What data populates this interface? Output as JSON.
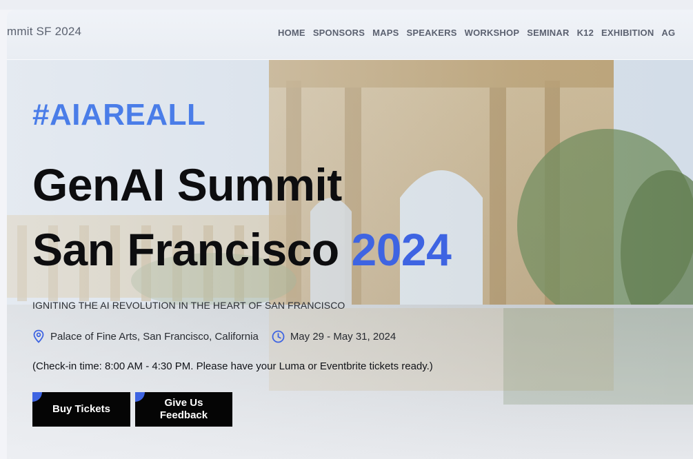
{
  "header": {
    "site_title": "mmit SF 2024",
    "nav": [
      "HOME",
      "SPONSORS",
      "MAPS",
      "SPEAKERS",
      "WORKSHOP",
      "SEMINAR",
      "K12",
      "EXHIBITION",
      "AG"
    ]
  },
  "hero": {
    "hashtag": "#AIAREALL",
    "title_line1": "GenAI Summit",
    "title_line2_text": "San Francisco ",
    "title_year": "2024",
    "tagline": "IGNITING THE AI REVOLUTION IN THE HEART OF SAN FRANCISCO",
    "location": "Palace of Fine Arts, San Francisco, California",
    "location_icon": "map-pin-icon",
    "dates": "May 29 - May 31, 2024",
    "dates_icon": "clock-icon",
    "checkin": "(Check-in time: 8:00 AM - 4:30 PM. Please have your Luma or Eventbrite tickets ready.)"
  },
  "buttons": {
    "buy_tickets": "Buy Tickets",
    "feedback_line1": "Give Us",
    "feedback_line2": "Feedback"
  },
  "colors": {
    "accent_blue": "#3e64e2",
    "hashtag_blue": "#4a7de8",
    "button_bg": "#050505"
  }
}
